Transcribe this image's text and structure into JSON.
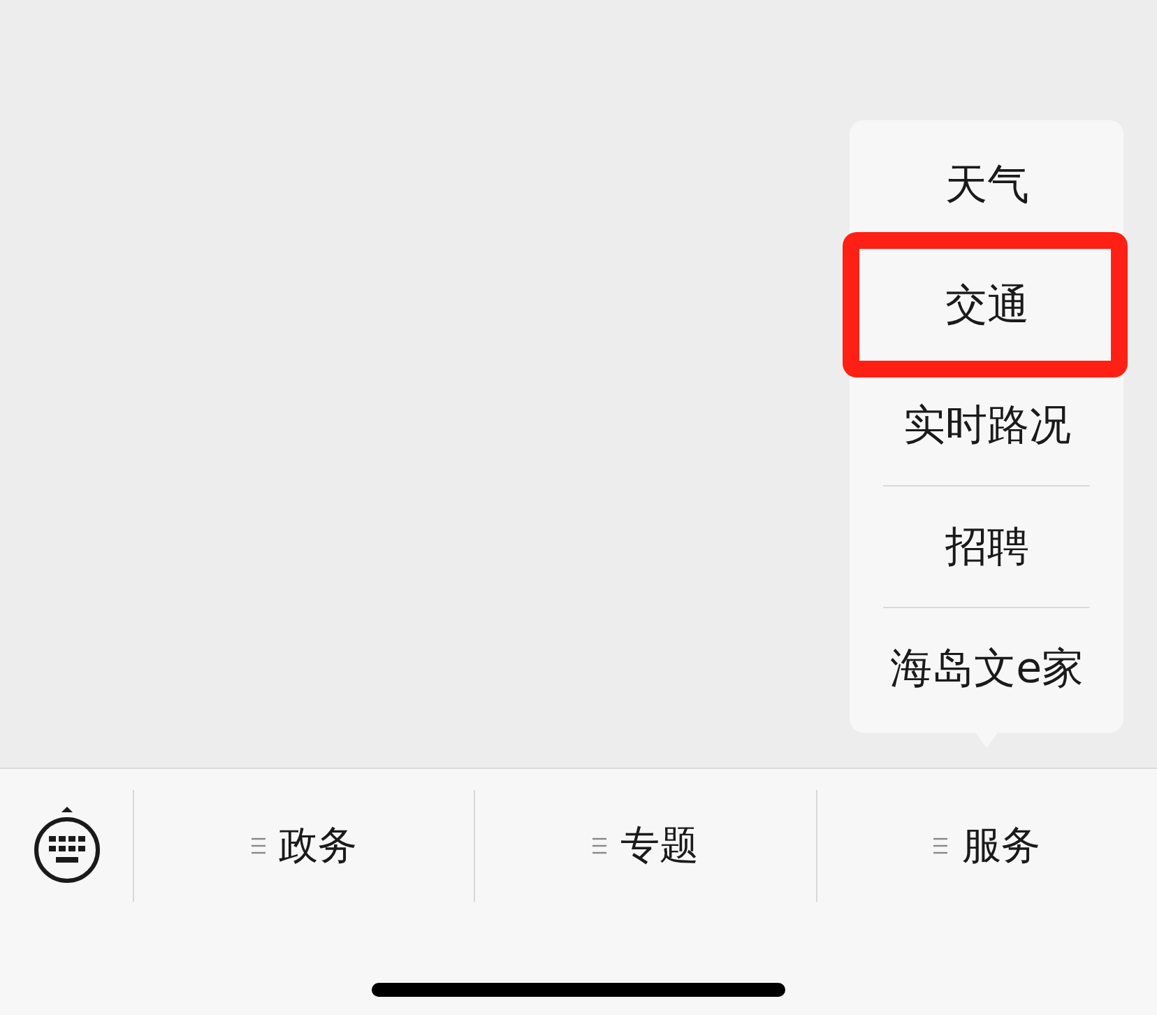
{
  "popup_menu": {
    "items": [
      {
        "label": "天气",
        "highlighted": false
      },
      {
        "label": "交通",
        "highlighted": true
      },
      {
        "label": "实时路况",
        "highlighted": false
      },
      {
        "label": "招聘",
        "highlighted": false
      },
      {
        "label": "海岛文e家",
        "highlighted": false
      }
    ]
  },
  "menu_bar": {
    "tabs": [
      {
        "label": "政务"
      },
      {
        "label": "专题"
      },
      {
        "label": "服务"
      }
    ]
  }
}
